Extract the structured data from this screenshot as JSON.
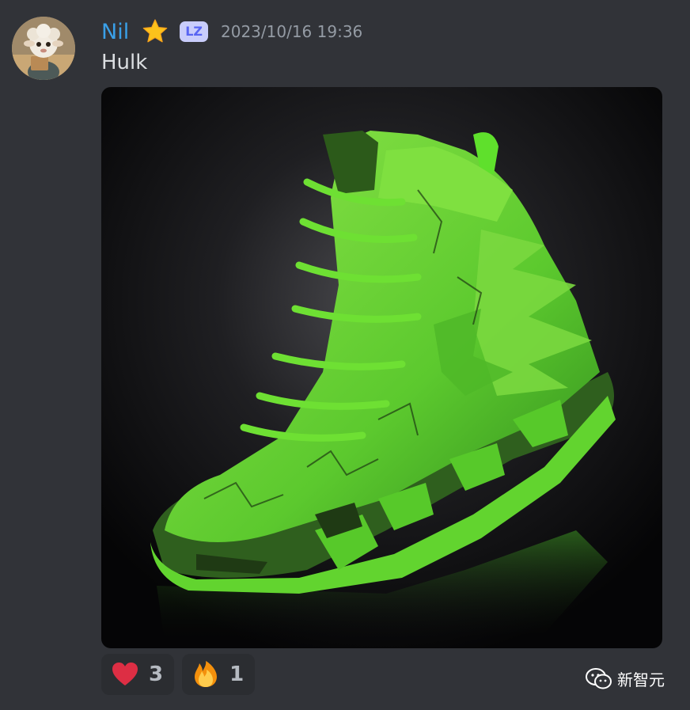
{
  "message": {
    "author": "Nil",
    "author_color": "#3aa0e8",
    "badge_icon": "star-icon",
    "server_tag": "LZ",
    "timestamp": "2023/10/16 19:36",
    "content": "Hulk",
    "attachment": {
      "description_icon": "green-hulk-sneaker-image"
    },
    "reactions": [
      {
        "emoji": "red-heart-icon",
        "count": "3"
      },
      {
        "emoji": "fire-icon",
        "count": "1"
      }
    ]
  },
  "watermark": {
    "icon": "wechat-icon",
    "text": "新智元"
  },
  "colors": {
    "background": "#313338",
    "reaction_bg": "#2b2d31",
    "tag_bg": "#c9cdfb",
    "tag_text": "#5865f2",
    "sneaker_green": "#6bd93a"
  }
}
